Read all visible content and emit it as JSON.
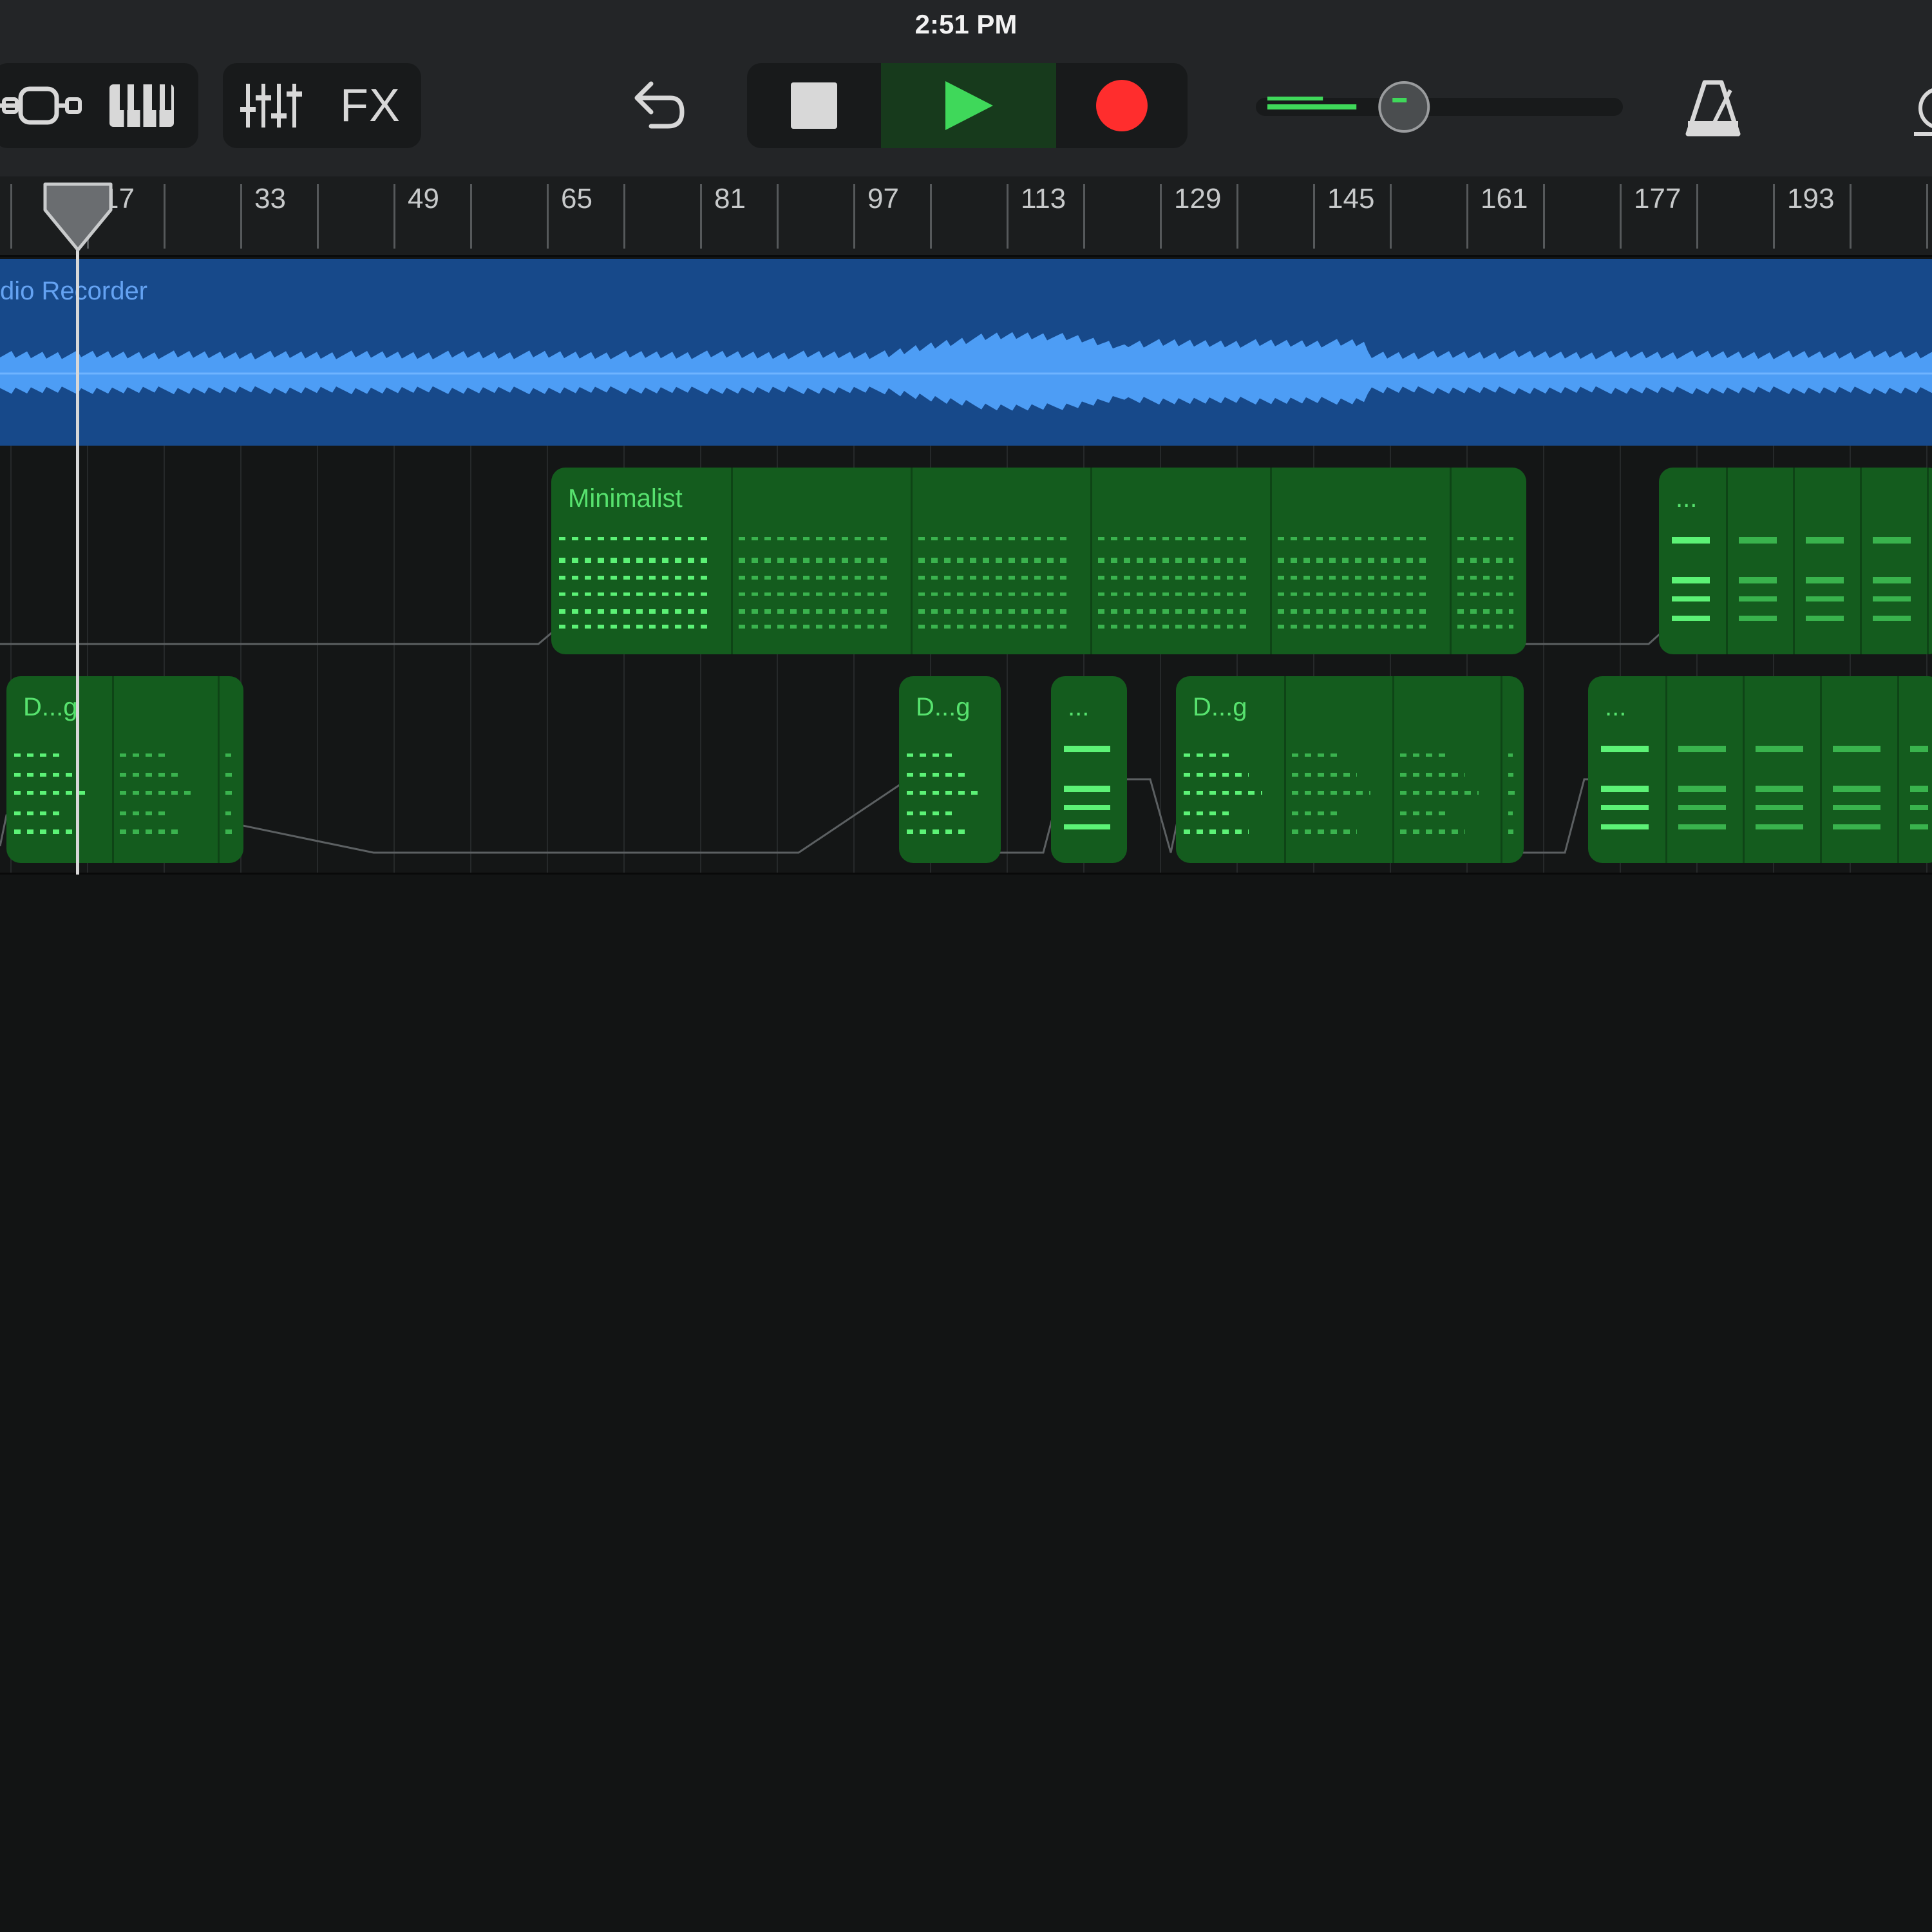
{
  "status_bar": {
    "time": "2:51 PM"
  },
  "toolbar": {
    "fx_label": "FX",
    "icons": {
      "tracks_view": "tracks-view-icon",
      "keyboard": "piano-keyboard-icon",
      "mixer": "mixer-sliders-icon",
      "undo": "undo-icon",
      "stop": "stop-icon",
      "play": "play-icon",
      "record": "record-icon",
      "metronome": "metronome-icon"
    },
    "master_volume_level": 0.33
  },
  "ruler": {
    "bar_numbers": [
      "17",
      "33",
      "49",
      "65",
      "81",
      "97",
      "113",
      "129",
      "145",
      "161",
      "177",
      "193"
    ]
  },
  "tracks": {
    "audio": {
      "label": "dio Recorder"
    },
    "track2_regions": [
      {
        "label": "Minimalist"
      },
      {
        "label": "..."
      }
    ],
    "track3_regions": [
      {
        "label": "D...g"
      },
      {
        "label": "D...g"
      },
      {
        "label": "..."
      },
      {
        "label": "D...g"
      },
      {
        "label": "..."
      }
    ]
  },
  "colors": {
    "background": "#121414",
    "toolbar": "#232527",
    "audio_region": "#17498a",
    "waveform": "#4d9df5",
    "midi_region": "#145c1e",
    "midi_notes": "#5cf276",
    "play": "#3fd85a",
    "record": "#ff2d2d"
  }
}
